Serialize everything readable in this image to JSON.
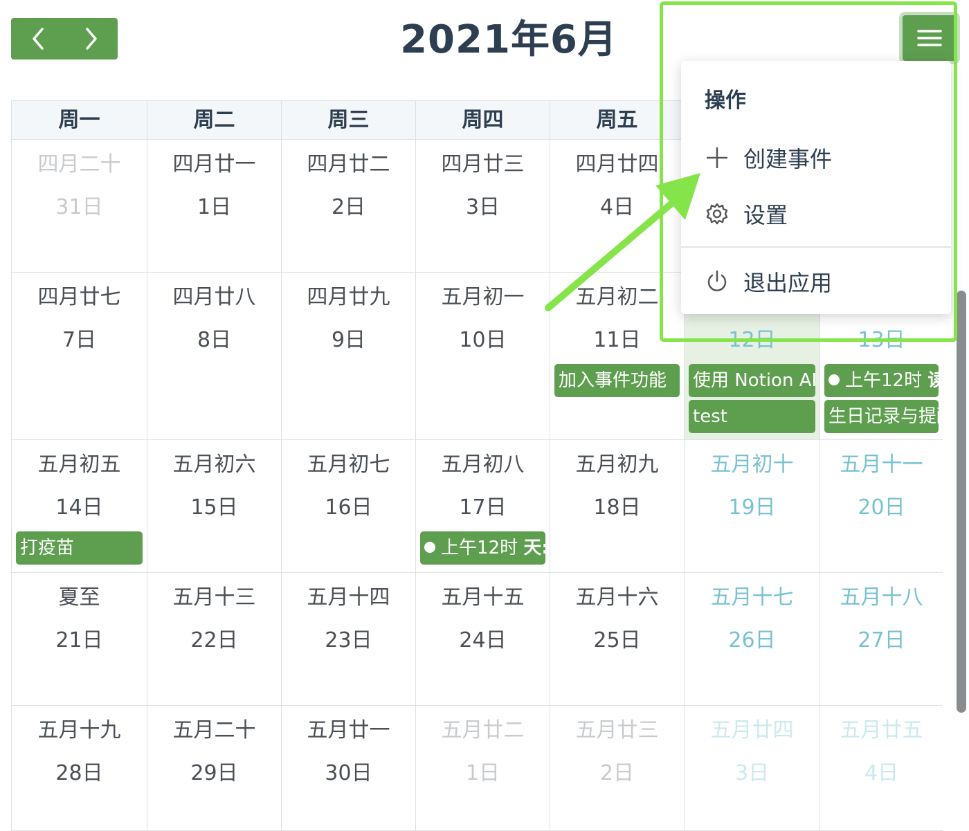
{
  "header": {
    "title": "2021年6月",
    "prev_icon": "chevron-left-icon",
    "next_icon": "chevron-right-icon",
    "menu_icon": "hamburger-menu-icon"
  },
  "weekdays": [
    "周一",
    "周二",
    "周三",
    "周四",
    "周五"
  ],
  "weeks": [
    [
      {
        "lunar": "四月二十",
        "day": "31日",
        "other": true
      },
      {
        "lunar": "四月廿一",
        "day": "1日"
      },
      {
        "lunar": "四月廿二",
        "day": "2日"
      },
      {
        "lunar": "四月廿三",
        "day": "3日"
      },
      {
        "lunar": "四月廿四",
        "day": "4日"
      }
    ],
    [
      {
        "lunar": "四月廿七",
        "day": "7日"
      },
      {
        "lunar": "四月廿八",
        "day": "8日"
      },
      {
        "lunar": "四月廿九",
        "day": "9日"
      },
      {
        "lunar": "五月初一",
        "day": "10日"
      },
      {
        "lunar": "五月初二",
        "day": "11日",
        "events": [
          {
            "text": "加入事件功能"
          }
        ]
      },
      {
        "lunar": "",
        "day": "12日",
        "weekend": true,
        "today": true,
        "events": [
          {
            "text": "使用 Notion AI"
          },
          {
            "text": "test"
          }
        ]
      },
      {
        "lunar": "",
        "day": "13日",
        "weekend": true,
        "events": [
          {
            "time": "上午12时",
            "text": "读书",
            "dot": true
          },
          {
            "text": "生日记录与提醒"
          }
        ]
      }
    ],
    [
      {
        "lunar": "五月初五",
        "day": "14日",
        "events": [
          {
            "text": "打疫苗"
          }
        ]
      },
      {
        "lunar": "五月初六",
        "day": "15日"
      },
      {
        "lunar": "五月初七",
        "day": "16日"
      },
      {
        "lunar": "五月初八",
        "day": "17日",
        "events": [
          {
            "time": "上午12时",
            "text": "天:",
            "dot": true
          }
        ]
      },
      {
        "lunar": "五月初九",
        "day": "18日"
      },
      {
        "lunar": "五月初十",
        "day": "19日",
        "weekend": true
      },
      {
        "lunar": "五月十一",
        "day": "20日",
        "weekend": true
      }
    ],
    [
      {
        "lunar": "夏至",
        "day": "21日"
      },
      {
        "lunar": "五月十三",
        "day": "22日"
      },
      {
        "lunar": "五月十四",
        "day": "23日"
      },
      {
        "lunar": "五月十五",
        "day": "24日"
      },
      {
        "lunar": "五月十六",
        "day": "25日"
      },
      {
        "lunar": "五月十七",
        "day": "26日",
        "weekend": true
      },
      {
        "lunar": "五月十八",
        "day": "27日",
        "weekend": true
      }
    ],
    [
      {
        "lunar": "五月十九",
        "day": "28日"
      },
      {
        "lunar": "五月二十",
        "day": "29日"
      },
      {
        "lunar": "五月廿一",
        "day": "30日"
      },
      {
        "lunar": "五月廿二",
        "day": "1日",
        "other": true
      },
      {
        "lunar": "五月廿三",
        "day": "2日",
        "other": true
      },
      {
        "lunar": "五月廿四",
        "day": "3日",
        "weekend": true,
        "other": true
      },
      {
        "lunar": "五月廿五",
        "day": "4日",
        "weekend": true,
        "other": true
      }
    ]
  ],
  "menu": {
    "header": "操作",
    "items": [
      {
        "label": "创建事件",
        "icon": "plus-icon"
      },
      {
        "label": "设置",
        "icon": "gear-icon"
      },
      {
        "label": "退出应用",
        "icon": "power-icon"
      }
    ]
  },
  "colors": {
    "accent": "#5e9e4f",
    "highlight": "#86e44b",
    "weekend_text": "#77c2d2",
    "today_bg": "#e6f0e3"
  }
}
